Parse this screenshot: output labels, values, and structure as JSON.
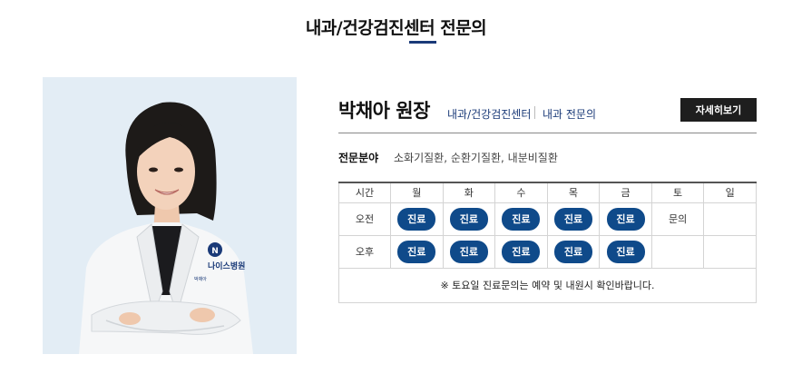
{
  "header": {
    "title": "내과/건강검진센터 전문의"
  },
  "doctor": {
    "name": "박채아 원장",
    "department": "내과/건강검진센터",
    "role": "내과 전문의",
    "detail_button": "자세히보기",
    "specialty_label": "전문분야",
    "specialty_value": "소화기질환, 순환기질환, 내분비질환",
    "badge_text": "나이스병원",
    "coat_name": "박채아"
  },
  "schedule": {
    "headers": [
      "시간",
      "월",
      "화",
      "수",
      "목",
      "금",
      "토",
      "일"
    ],
    "rows": [
      {
        "label": "오전",
        "cells": [
          "진료",
          "진료",
          "진료",
          "진료",
          "진료",
          "문의",
          ""
        ]
      },
      {
        "label": "오후",
        "cells": [
          "진료",
          "진료",
          "진료",
          "진료",
          "진료",
          "",
          ""
        ]
      }
    ],
    "note": "※ 토요일 진료문의는 예약 및 내원시 확인바랍니다."
  },
  "colors": {
    "accent": "#1a3a78",
    "pill": "#0f4a8a",
    "button": "#1e1e1e",
    "photo_bg": "#e3edf5"
  }
}
